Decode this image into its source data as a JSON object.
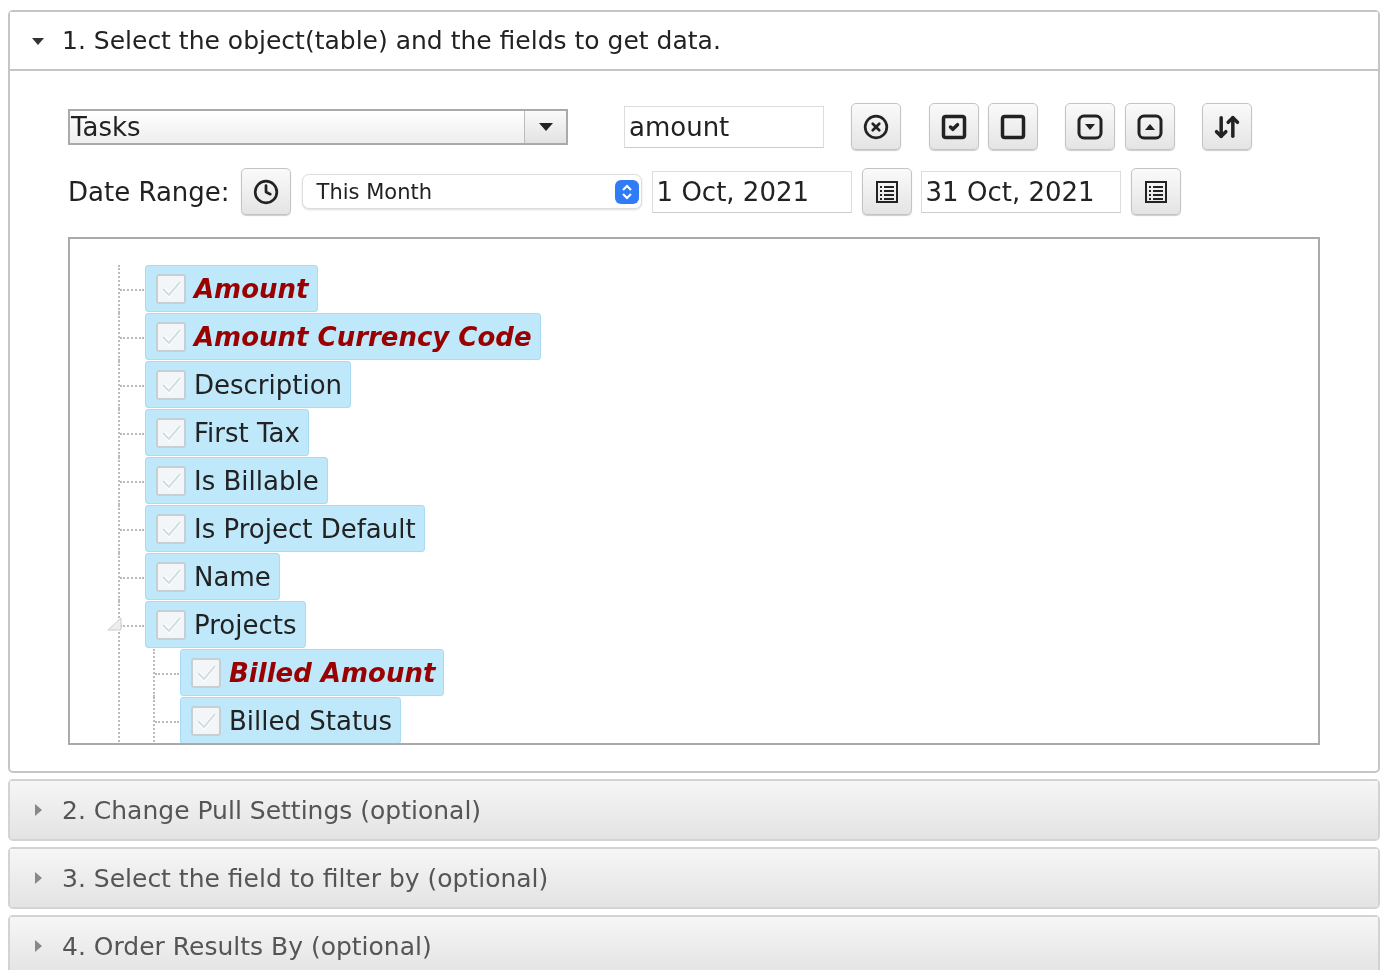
{
  "sections": [
    {
      "title": "1. Select the object(table) and the fields to get data.",
      "expanded": true
    },
    {
      "title": "2. Change Pull Settings (optional)",
      "expanded": false
    },
    {
      "title": "3. Select the field to filter by (optional)",
      "expanded": false
    },
    {
      "title": "4. Order Results By (optional)",
      "expanded": false
    }
  ],
  "object_select": {
    "value": "Tasks"
  },
  "search_field": {
    "value": "amount"
  },
  "date_range": {
    "label": "Date Range:",
    "preset": "This Month",
    "start": "1 Oct, 2021",
    "end": "31 Oct, 2021"
  },
  "fields": [
    {
      "label": "Amount",
      "checked": true,
      "selected": true,
      "matched": true
    },
    {
      "label": "Amount Currency Code",
      "checked": true,
      "selected": true,
      "matched": true
    },
    {
      "label": "Description",
      "checked": true,
      "selected": true,
      "matched": false
    },
    {
      "label": "First Tax",
      "checked": true,
      "selected": true,
      "matched": false
    },
    {
      "label": "Is Billable",
      "checked": true,
      "selected": true,
      "matched": false
    },
    {
      "label": "Is Project Default",
      "checked": true,
      "selected": true,
      "matched": false
    },
    {
      "label": "Name",
      "checked": true,
      "selected": true,
      "matched": false
    },
    {
      "label": "Projects",
      "checked": true,
      "selected": true,
      "matched": false,
      "expanded": true,
      "children": [
        {
          "label": "Billed Amount",
          "checked": true,
          "selected": true,
          "matched": true
        },
        {
          "label": "Billed Status",
          "checked": true,
          "selected": true,
          "matched": false
        }
      ]
    }
  ]
}
